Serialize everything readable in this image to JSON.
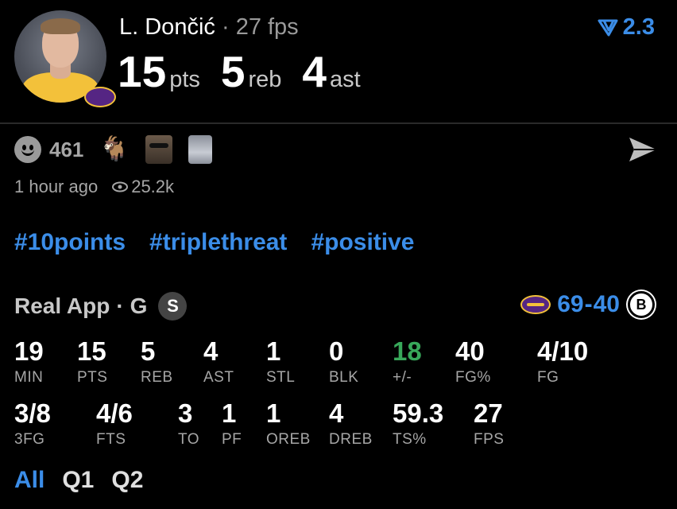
{
  "player": {
    "name": "L. Dončić",
    "separator": "·",
    "fps_label": "27 fps",
    "statline": [
      {
        "value": "15",
        "unit": "pts"
      },
      {
        "value": "5",
        "unit": "reb"
      },
      {
        "value": "4",
        "unit": "ast"
      }
    ]
  },
  "rating": {
    "value": "2.3",
    "icon": "down-funnel-icon",
    "color": "#3b8de8"
  },
  "reactions": {
    "count": "461",
    "emoji": "🐐",
    "time_ago": "1 hour ago",
    "views": "25.2k"
  },
  "hashtags": [
    "#10points",
    "#triplethreat",
    "#positive"
  ],
  "game": {
    "source": "Real App",
    "separator": "·",
    "position": "G",
    "badge": "S",
    "score_home": "69",
    "score_dash": "-",
    "score_away": "40"
  },
  "stats_row1": [
    {
      "value": "19",
      "label": "MIN"
    },
    {
      "value": "15",
      "label": "PTS"
    },
    {
      "value": "5",
      "label": "REB"
    },
    {
      "value": "4",
      "label": "AST"
    },
    {
      "value": "1",
      "label": "STL"
    },
    {
      "value": "0",
      "label": "BLK"
    },
    {
      "value": "18",
      "label": "+/-"
    },
    {
      "value": "40",
      "label": "FG%"
    },
    {
      "value": "4/10",
      "label": "FG"
    }
  ],
  "stats_row2": [
    {
      "value": "3/8",
      "label": "3FG"
    },
    {
      "value": "4/6",
      "label": "FTS"
    },
    {
      "value": "3",
      "label": "TO"
    },
    {
      "value": "1",
      "label": "PF"
    },
    {
      "value": "1",
      "label": "OREB"
    },
    {
      "value": "4",
      "label": "DREB"
    },
    {
      "value": "59.3",
      "label": "TS%"
    },
    {
      "value": "27",
      "label": "FPS"
    }
  ],
  "quarters": [
    "All",
    "Q1",
    "Q2"
  ],
  "colors": {
    "accent": "#3b8de8",
    "positive": "#38a85a",
    "muted": "#a6a6a6"
  }
}
